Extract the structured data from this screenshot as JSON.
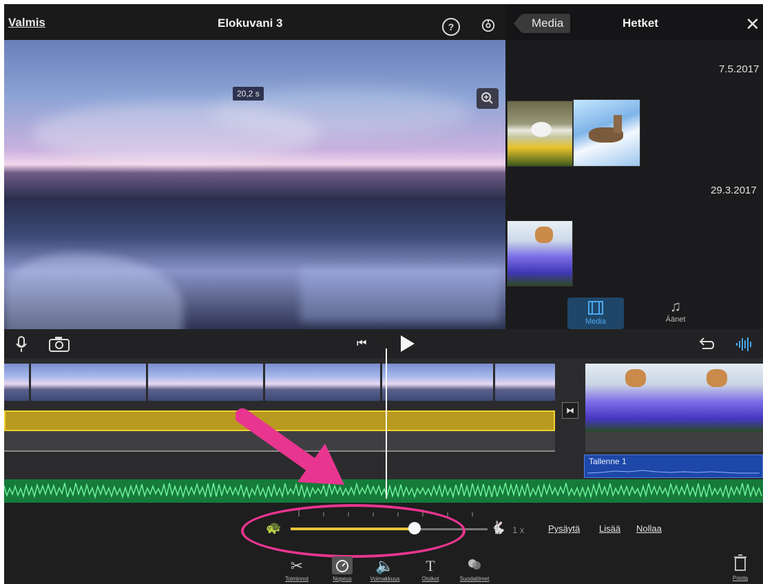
{
  "header": {
    "done_label": "Valmis",
    "project_title": "Elokuvani 3",
    "help_icon": "question-circle-icon",
    "settings_icon": "gear-icon"
  },
  "preview": {
    "clip_duration": "20,2 s",
    "zoom_icon": "zoom-in-icon"
  },
  "media_panel": {
    "back_label": "Media",
    "title": "Hetket",
    "close_icon": "close-icon",
    "groups": [
      {
        "date": "7.5.2017",
        "thumbnails": [
          "rabbit-flowers",
          "deer-snow"
        ]
      },
      {
        "date": "29.3.2017",
        "thumbnails": [
          "dog-crocus"
        ]
      }
    ],
    "tabs": [
      {
        "label": "Media",
        "icon": "filmstrip-icon",
        "active": true
      },
      {
        "label": "Äänet",
        "icon": "music-note-icon",
        "active": false
      }
    ]
  },
  "toolbar": {
    "mic_icon": "microphone-icon",
    "camera_icon": "camera-icon",
    "skip_icon": "skip-to-start-icon",
    "play_icon": "play-icon",
    "undo_icon": "undo-icon",
    "waveform_icon": "waveform-icon"
  },
  "timeline": {
    "recording_label": "Tallenne 1"
  },
  "speed": {
    "value": 0.63,
    "speed_label": "1 x",
    "pause_label": "Pysäytä",
    "add_label": "Lisää",
    "reset_label": "Nollaa"
  },
  "bottom_tools": [
    {
      "label": "Toiminnot",
      "icon": "scissors-icon"
    },
    {
      "label": "Nopeus",
      "icon": "speedometer-icon"
    },
    {
      "label": "Voimakkuus",
      "icon": "speaker-icon"
    },
    {
      "label": "Otsikot",
      "icon": "title-T-icon"
    },
    {
      "label": "Suodattimet",
      "icon": "filters-icon"
    }
  ],
  "delete_label": "Poista",
  "colors": {
    "accent_blue": "#4aa8f0",
    "annotation_pink": "#e8358f",
    "audio_green": "#157a3a",
    "audio_yellow": "#f0d030",
    "slider_yellow": "#e8c33a"
  }
}
